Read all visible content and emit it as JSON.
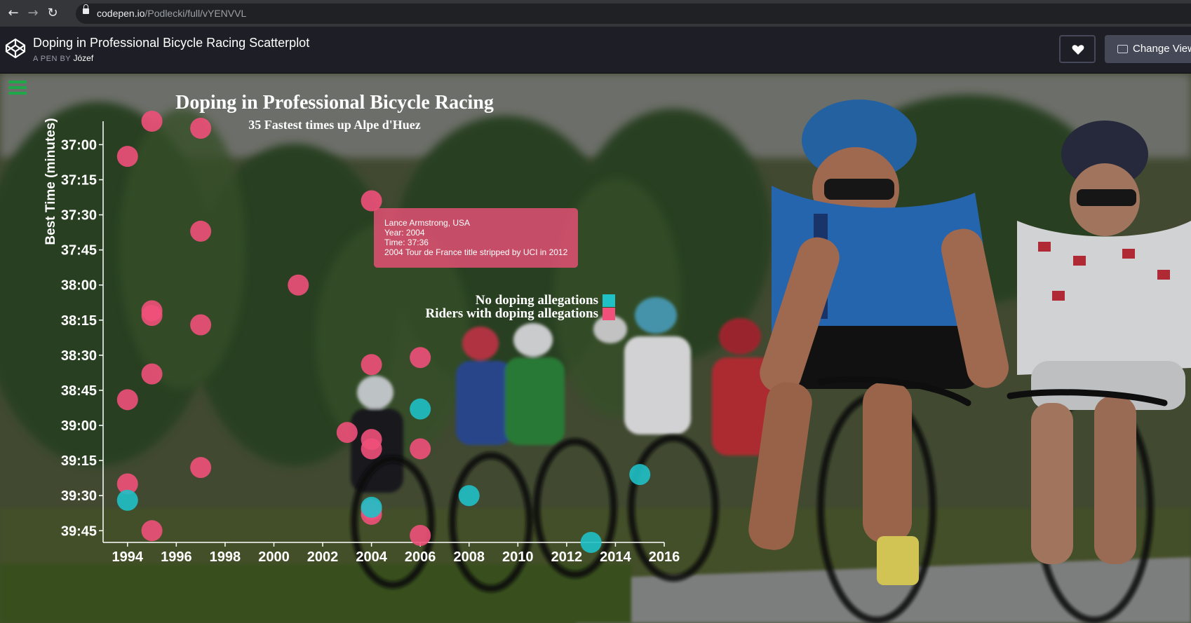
{
  "browser": {
    "url_host": "codepen.io",
    "url_path": "/Podlecki/full/vYENVVL"
  },
  "header": {
    "pen_title": "Doping in Professional Bicycle Racing Scatterplot",
    "pen_by_label": "A PEN BY",
    "author": "Józef",
    "change_view_label": "Change View"
  },
  "chart_data": {
    "type": "scatter",
    "title": "Doping in Professional Bicycle Racing",
    "subtitle": "35 Fastest times up Alpe d'Huez",
    "ylabel": "Best Time (minutes)",
    "xlabel": "",
    "x_ticks": [
      "1994",
      "1996",
      "1998",
      "2000",
      "2002",
      "2004",
      "2006",
      "2008",
      "2010",
      "2012",
      "2014",
      "2016"
    ],
    "y_ticks": [
      "37:00",
      "37:15",
      "37:30",
      "37:45",
      "38:00",
      "38:15",
      "38:30",
      "38:45",
      "39:00",
      "39:15",
      "39:30",
      "39:45"
    ],
    "xlim": [
      1993,
      2016
    ],
    "ylim_seconds": [
      2210,
      2390
    ],
    "y_reversed": true,
    "grid": false,
    "legend_position": "middle",
    "legend": [
      {
        "label": "No doping allegations",
        "color": "#1fc0c6"
      },
      {
        "label": "Riders with doping allegations",
        "color": "#f0507a"
      }
    ],
    "series": [
      {
        "name": "Riders with doping allegations",
        "color": "#f0507a",
        "points": [
          {
            "year": 1995,
            "seconds": 2210
          },
          {
            "year": 1997,
            "seconds": 2213
          },
          {
            "year": 1994,
            "seconds": 2225
          },
          {
            "year": 2004,
            "seconds": 2244
          },
          {
            "year": 1997,
            "seconds": 2257
          },
          {
            "year": 2001,
            "seconds": 2280
          },
          {
            "year": 1995,
            "seconds": 2291
          },
          {
            "year": 1995,
            "seconds": 2293
          },
          {
            "year": 1997,
            "seconds": 2297
          },
          {
            "year": 2006,
            "seconds": 2311
          },
          {
            "year": 2004,
            "seconds": 2314
          },
          {
            "year": 1995,
            "seconds": 2318
          },
          {
            "year": 1994,
            "seconds": 2329
          },
          {
            "year": 2003,
            "seconds": 2343
          },
          {
            "year": 2004,
            "seconds": 2346
          },
          {
            "year": 2004,
            "seconds": 2350
          },
          {
            "year": 2006,
            "seconds": 2350
          },
          {
            "year": 1997,
            "seconds": 2358
          },
          {
            "year": 1994,
            "seconds": 2365
          },
          {
            "year": 2004,
            "seconds": 2376
          },
          {
            "year": 2004,
            "seconds": 2378
          },
          {
            "year": 1995,
            "seconds": 2385
          },
          {
            "year": 2006,
            "seconds": 2387
          }
        ]
      },
      {
        "name": "No doping allegations",
        "color": "#1fc0c6",
        "points": [
          {
            "year": 2006,
            "seconds": 2333
          },
          {
            "year": 2015,
            "seconds": 2361
          },
          {
            "year": 2008,
            "seconds": 2370
          },
          {
            "year": 1994,
            "seconds": 2372
          },
          {
            "year": 2004,
            "seconds": 2375
          },
          {
            "year": 2013,
            "seconds": 2390
          }
        ]
      }
    ]
  },
  "tooltip": {
    "line1": "Lance Armstrong, USA",
    "line2": "Year: 2004",
    "line3": "Time: 37:36",
    "line4": "2004 Tour de France title stripped by UCI in 2012"
  }
}
